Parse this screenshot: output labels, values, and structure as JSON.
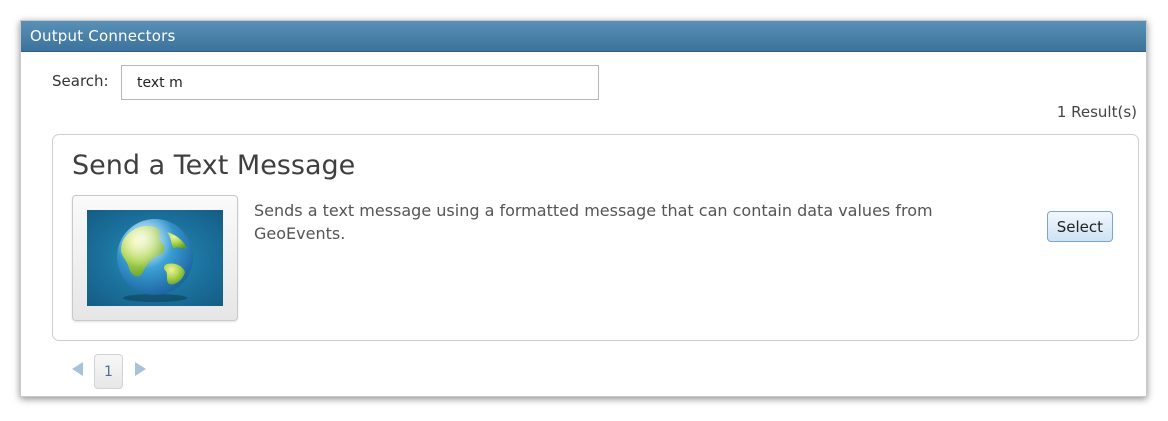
{
  "panel": {
    "title": "Output Connectors"
  },
  "search": {
    "label": "Search:",
    "value": "text m"
  },
  "results": {
    "count_text": "1 Result(s)"
  },
  "connectors": [
    {
      "title": "Send a Text Message",
      "description": "Sends a text message using a formatted message that can contain data values from GeoEvents.",
      "icon": "globe-icon",
      "select_label": "Select"
    }
  ],
  "pagination": {
    "pages": [
      "1"
    ],
    "current": "1"
  },
  "colors": {
    "titlebar": "#4a81a9",
    "accent": "#7aa7cf"
  }
}
